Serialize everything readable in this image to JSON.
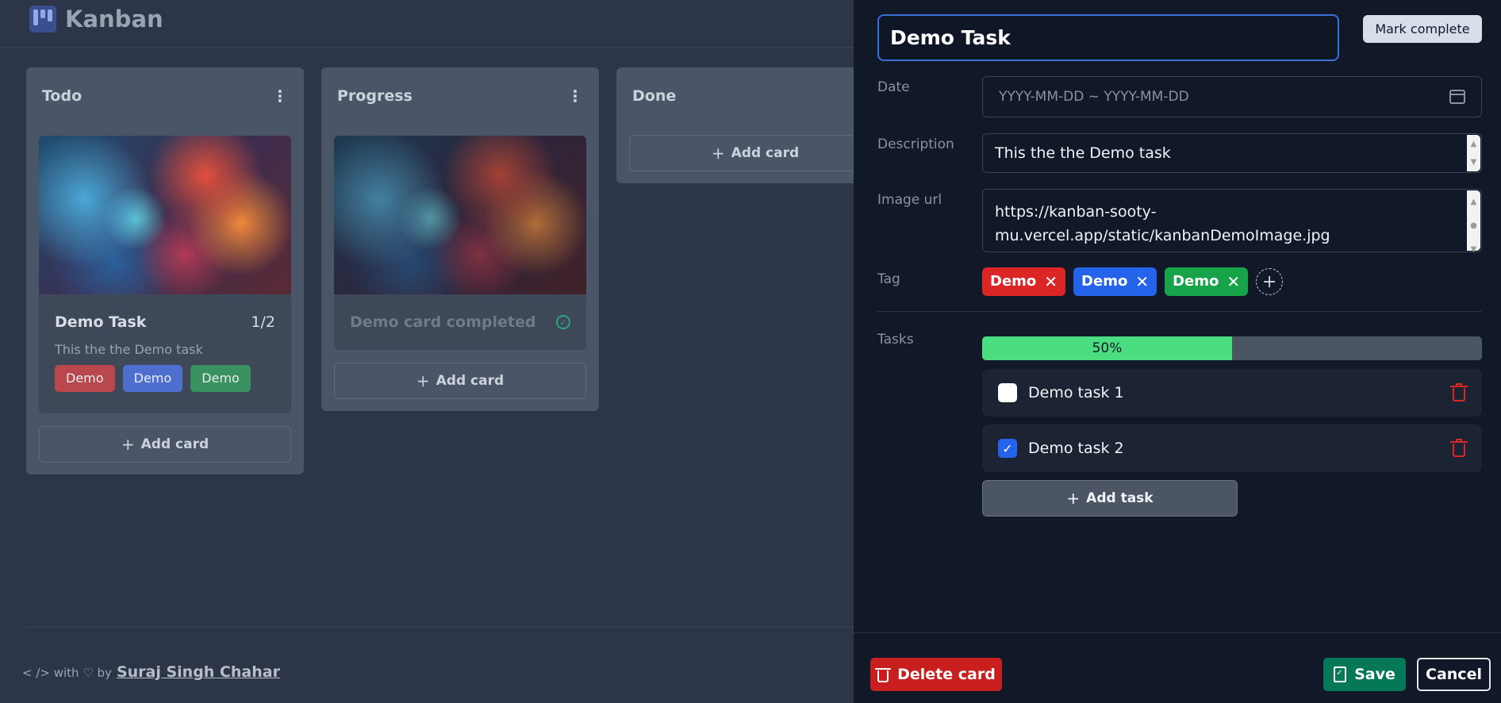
{
  "app": {
    "title": "Kanban"
  },
  "columns": [
    {
      "title": "Todo",
      "cards": [
        {
          "title": "Demo Task",
          "count": "1/2",
          "description": "This the the Demo task",
          "tags": [
            {
              "label": "Demo",
              "color": "#b8474e"
            },
            {
              "label": "Demo",
              "color": "#4f6fcf"
            },
            {
              "label": "Demo",
              "color": "#3a9160"
            }
          ]
        }
      ],
      "add_label": "Add card"
    },
    {
      "title": "Progress",
      "cards": [
        {
          "title": "Demo card completed",
          "completed": true
        }
      ],
      "add_label": "Add card"
    },
    {
      "title": "Done",
      "cards": [],
      "add_label": "Add card"
    }
  ],
  "footer": {
    "prefix": "< /> with ♡ by",
    "author": "Suraj Singh Chahar"
  },
  "editor": {
    "title_value": "Demo Task",
    "mark_complete_label": "Mark complete",
    "date": {
      "label": "Date",
      "placeholder": "YYYY-MM-DD ~ YYYY-MM-DD"
    },
    "description": {
      "label": "Description",
      "value": "This the the Demo task"
    },
    "image_url": {
      "label": "Image url",
      "line1": "https://kanban-sooty-",
      "line2": "mu.vercel.app/static/kanbanDemoImage.jpg"
    },
    "tag": {
      "label": "Tag",
      "items": [
        {
          "label": "Demo",
          "color": "#dc2626"
        },
        {
          "label": "Demo",
          "color": "#2563eb"
        },
        {
          "label": "Demo",
          "color": "#16a34a"
        }
      ]
    },
    "tasks": {
      "label": "Tasks",
      "progress": 0.5,
      "progress_text": "50%",
      "items": [
        {
          "label": "Demo task 1",
          "checked": false
        },
        {
          "label": "Demo task 2",
          "checked": true
        }
      ],
      "add_label": "Add task"
    },
    "delete_label": "Delete card",
    "save_label": "Save",
    "cancel_label": "Cancel"
  }
}
